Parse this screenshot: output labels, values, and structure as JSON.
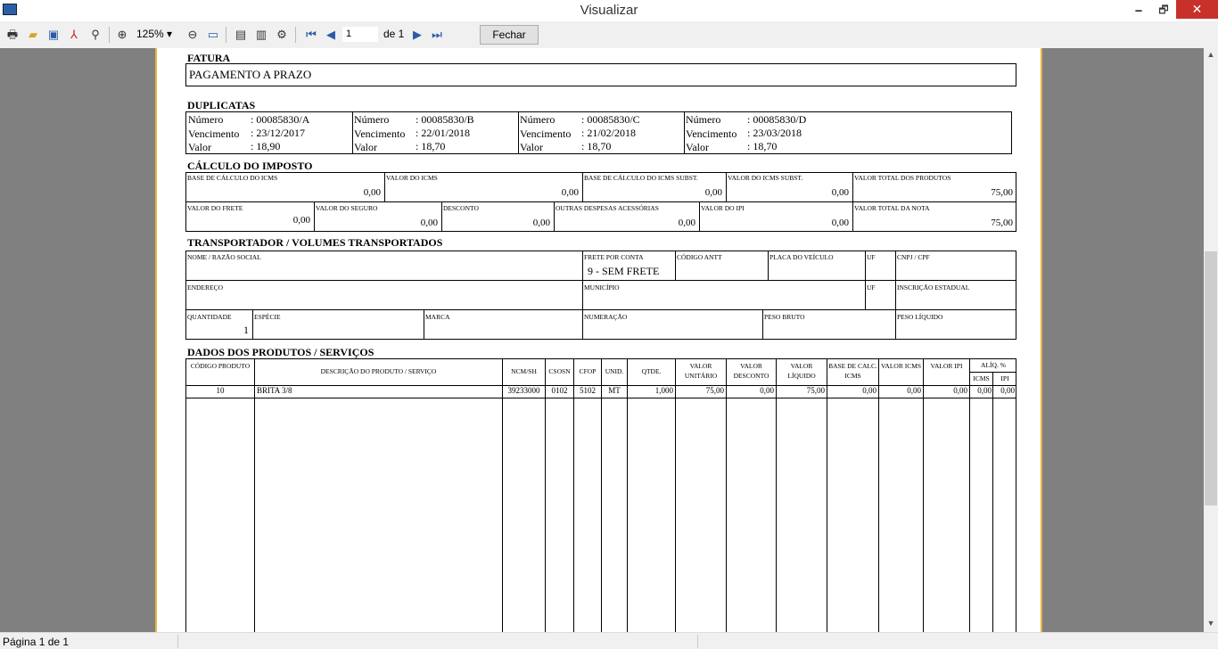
{
  "window": {
    "title": "Visualizar",
    "minimize": "🗕",
    "maximize": "🗗",
    "close": "✕"
  },
  "toolbar": {
    "zoom": "125%",
    "page": "1",
    "page_of": "de 1",
    "close_label": "Fechar",
    "icons": [
      "print-icon",
      "open-icon",
      "save-icon",
      "pdf-icon",
      "find-icon",
      "zoom-in-icon",
      "zoom-out-icon",
      "fit-icon",
      "one-page-icon",
      "two-page-icon",
      "settings-icon",
      "first-page-icon",
      "prev-page-icon",
      "next-page-icon",
      "last-page-icon"
    ]
  },
  "status": {
    "text": "Página 1 de 1"
  },
  "doc": {
    "fatura": {
      "title": "FATURA",
      "value": "PAGAMENTO A PRAZO"
    },
    "duplicatas": {
      "title": "DUPLICATAS",
      "labels": {
        "numero": "Número",
        "vencimento": "Vencimento",
        "valor": "Valor"
      },
      "items": [
        {
          "numero": ": 00085830/A",
          "vencimento": ": 23/12/2017",
          "valor": ": 18,90"
        },
        {
          "numero": ": 00085830/B",
          "vencimento": ": 22/01/2018",
          "valor": ": 18,70"
        },
        {
          "numero": ": 00085830/C",
          "vencimento": ": 21/02/2018",
          "valor": ": 18,70"
        },
        {
          "numero": ": 00085830/D",
          "vencimento": ": 23/03/2018",
          "valor": ": 18,70"
        }
      ]
    },
    "imposto": {
      "title": "CÁLCULO DO IMPOSTO",
      "row1": [
        {
          "label": "BASE DE CÁLCULO DO ICMS",
          "value": "0,00"
        },
        {
          "label": "VALOR DO ICMS",
          "value": "0,00"
        },
        {
          "label": "BASE DE CÁLCULO DO ICMS SUBST.",
          "value": "0,00"
        },
        {
          "label": "VALOR DO ICMS SUBST.",
          "value": "0,00"
        },
        {
          "label": "VALOR TOTAL DOS PRODUTOS",
          "value": "75,00"
        }
      ],
      "row2": [
        {
          "label": "VALOR DO FRETE",
          "value": "0,00"
        },
        {
          "label": "VALOR DO SEGURO",
          "value": "0,00"
        },
        {
          "label": "DESCONTO",
          "value": "0,00"
        },
        {
          "label": "OUTRAS DESPESAS ACESSÓRIAS",
          "value": "0,00"
        },
        {
          "label": "VALOR DO IPI",
          "value": "0,00"
        },
        {
          "label": "VALOR TOTAL DA NOTA",
          "value": "75,00"
        }
      ]
    },
    "transp": {
      "title": "TRANSPORTADOR / VOLUMES TRANSPORTADOS",
      "nome": "NOME / RAZÃO SOCIAL",
      "frete": "FRETE POR CONTA",
      "frete_val": "9 - SEM FRETE",
      "antt": "CÓDIGO ANTT",
      "placa": "PLACA DO VEÍCULO",
      "uf": "UF",
      "cnpj": "CNPJ / CPF",
      "endereco": "ENDEREÇO",
      "municipio": "MUNICÍPIO",
      "uf2": "UF",
      "ie": "INSCRIÇÃO ESTADUAL",
      "quantidade": "QUANTIDADE",
      "quantidade_val": "1",
      "especie": "ESPÉCIE",
      "marca": "MARCA",
      "numeracao": "NUMERAÇÃO",
      "peso_bruto": "PESO BRUTO",
      "peso_liquido": "PESO LÍQUIDO"
    },
    "produtos": {
      "title": "DADOS DOS PRODUTOS / SERVIÇOS",
      "headers": {
        "codigo": "CÓDIGO PRODUTO",
        "descricao": "DESCRIÇÃO DO PRODUTO / SERVIÇO",
        "ncm": "NCM/SH",
        "csosn": "CSOSN",
        "cfop": "CFOP",
        "unid": "UNID.",
        "qtde": "QTDE.",
        "vunit": "VALOR UNITÁRIO",
        "vdesc": "VALOR DESCONTO",
        "vliq": "VALOR LÍQUIDO",
        "bcicms": "BASE DE CALC. ICMS",
        "vicms": "VALOR ICMS",
        "vipi": "VALOR IPI",
        "aliq": "ALÍQ. %",
        "aicms": "ICMS",
        "aipi": "IPI"
      },
      "row": {
        "codigo": "10",
        "descricao": "BRITA 3/8",
        "ncm": "39233000",
        "csosn": "0102",
        "cfop": "5102",
        "unid": "MT",
        "qtde": "1,000",
        "vunit": "75,00",
        "vdesc": "0,00",
        "vliq": "75,00",
        "bcicms": "0,00",
        "vicms": "0,00",
        "vipi": "0,00",
        "aicms": "0,00",
        "aipi": "0,00"
      }
    }
  }
}
